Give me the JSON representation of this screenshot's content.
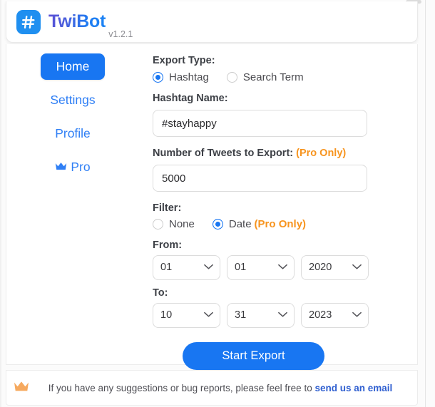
{
  "app": {
    "brand": "TwiBot",
    "version": "v1.2.1",
    "logo_icon": "hash-icon",
    "accent_blue": "#1876f2",
    "pro_orange": "#f7941e",
    "link_blue": "#2f5fd0"
  },
  "sidebar": {
    "items": [
      {
        "label": "Home",
        "active": true,
        "icon": ""
      },
      {
        "label": "Settings",
        "active": false,
        "icon": ""
      },
      {
        "label": "Profile",
        "active": false,
        "icon": ""
      },
      {
        "label": "Pro",
        "active": false,
        "icon": "crown-icon"
      }
    ]
  },
  "form": {
    "export_type": {
      "label": "Export Type:",
      "options": [
        {
          "label": "Hashtag",
          "selected": true
        },
        {
          "label": "Search Term",
          "selected": false
        }
      ]
    },
    "hashtag": {
      "label": "Hashtag Name:",
      "value": "#stayhappy",
      "placeholder": "#stayhappy"
    },
    "tweet_count": {
      "label": "Number of Tweets to Export:",
      "pro_tag": "(Pro Only)",
      "value": "5000",
      "placeholder": "5000"
    },
    "filter": {
      "label": "Filter:",
      "options": [
        {
          "label": "None",
          "selected": false,
          "pro_tag": ""
        },
        {
          "label": "Date",
          "selected": true,
          "pro_tag": "(Pro Only)"
        }
      ]
    },
    "from": {
      "label": "From:",
      "month": "01",
      "day": "01",
      "year": "2020"
    },
    "to": {
      "label": "To:",
      "month": "10",
      "day": "31",
      "year": "2023"
    },
    "submit_label": "Start Export"
  },
  "footer": {
    "crown_icon": "crown-icon",
    "message": "If you have any suggestions or bug reports, please feel free to",
    "link_label": "send us an email"
  }
}
